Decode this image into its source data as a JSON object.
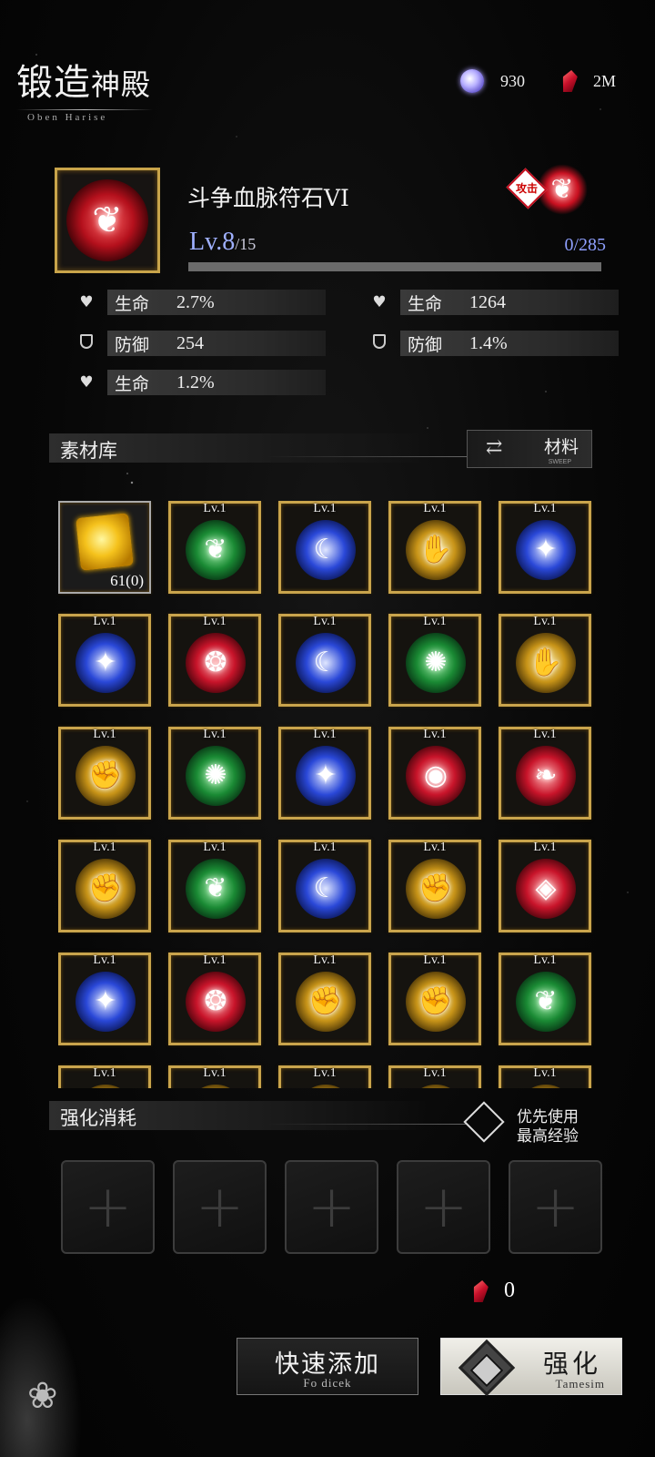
{
  "header": {
    "title_main": "锻造",
    "title_small": "神殿",
    "subtitle": "Oben Harise",
    "crystals": "930",
    "rubies": "2M"
  },
  "item": {
    "name": "斗争血脉符石VI",
    "level": "Lv.8",
    "level_max": "/15",
    "exp_text": "0/285",
    "exp_fraction": 0,
    "type_tag": "攻击"
  },
  "stats": {
    "left": [
      {
        "icon": "heart-icon",
        "name": "生命",
        "value": "2.7%"
      },
      {
        "icon": "shield-icon",
        "name": "防御",
        "value": "254"
      },
      {
        "icon": "heart-icon",
        "name": "生命",
        "value": "1.2%"
      }
    ],
    "right": [
      {
        "icon": "heart-icon",
        "name": "生命",
        "value": "1264"
      },
      {
        "icon": "shield-icon",
        "name": "防御",
        "value": "1.4%"
      }
    ]
  },
  "library": {
    "label": "素材库",
    "sort_label": "材料",
    "sort_sub": "SWEEP"
  },
  "material": {
    "count": "61(0)"
  },
  "runes": [
    {
      "level": "Lv.1",
      "color": "green",
      "glyph": "❦"
    },
    {
      "level": "Lv.1",
      "color": "blue",
      "glyph": "☾"
    },
    {
      "level": "Lv.1",
      "color": "gold",
      "glyph": "✋"
    },
    {
      "level": "Lv.1",
      "color": "blue",
      "glyph": "✦"
    },
    {
      "level": "Lv.1",
      "color": "blue",
      "glyph": "✦"
    },
    {
      "level": "Lv.1",
      "color": "red",
      "glyph": "❂"
    },
    {
      "level": "Lv.1",
      "color": "blue",
      "glyph": "☾"
    },
    {
      "level": "Lv.1",
      "color": "green",
      "glyph": "✺"
    },
    {
      "level": "Lv.1",
      "color": "gold",
      "glyph": "✋"
    },
    {
      "level": "Lv.1",
      "color": "gold",
      "glyph": "✊"
    },
    {
      "level": "Lv.1",
      "color": "green",
      "glyph": "✺"
    },
    {
      "level": "Lv.1",
      "color": "blue",
      "glyph": "✦"
    },
    {
      "level": "Lv.1",
      "color": "red",
      "glyph": "◉"
    },
    {
      "level": "Lv.1",
      "color": "red",
      "glyph": "❧"
    },
    {
      "level": "Lv.1",
      "color": "gold",
      "glyph": "✊"
    },
    {
      "level": "Lv.1",
      "color": "green",
      "glyph": "❦"
    },
    {
      "level": "Lv.1",
      "color": "blue",
      "glyph": "☾"
    },
    {
      "level": "Lv.1",
      "color": "gold",
      "glyph": "✊"
    },
    {
      "level": "Lv.1",
      "color": "red",
      "glyph": "◈"
    },
    {
      "level": "Lv.1",
      "color": "blue",
      "glyph": "✦"
    },
    {
      "level": "Lv.1",
      "color": "red",
      "glyph": "❂"
    },
    {
      "level": "Lv.1",
      "color": "gold",
      "glyph": "✊"
    },
    {
      "level": "Lv.1",
      "color": "gold",
      "glyph": "✊"
    },
    {
      "level": "Lv.1",
      "color": "green",
      "glyph": "❦"
    },
    {
      "level": "Lv.1",
      "color": "gold",
      "glyph": ""
    },
    {
      "level": "Lv.1",
      "color": "gold",
      "glyph": ""
    },
    {
      "level": "Lv.1",
      "color": "gold",
      "glyph": ""
    },
    {
      "level": "Lv.1",
      "color": "gold",
      "glyph": ""
    },
    {
      "level": "Lv.1",
      "color": "gold",
      "glyph": ""
    }
  ],
  "consume": {
    "label": "强化消耗",
    "priority_line1": "优先使用",
    "priority_line2": "最高经验",
    "cost": "0"
  },
  "buttons": {
    "quick_add": "快速添加",
    "quick_add_sub": "Fo dicek",
    "upgrade": "强化",
    "upgrade_sub": "Tamesim"
  },
  "colors": {
    "gold_frame": "#c9a44c",
    "exp_blue": "#9aa4ff",
    "ruby": "#c8102a"
  }
}
